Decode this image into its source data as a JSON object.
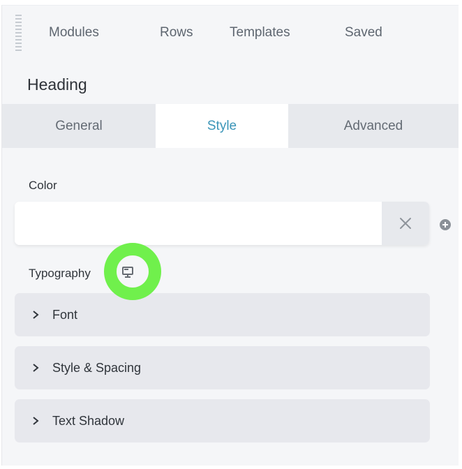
{
  "nav": {
    "items": [
      {
        "label": "Modules"
      },
      {
        "label": "Rows"
      },
      {
        "label": "Templates"
      },
      {
        "label": "Saved"
      }
    ]
  },
  "panel": {
    "title": "Heading"
  },
  "tabs": [
    {
      "label": "General",
      "active": false
    },
    {
      "label": "Style",
      "active": true
    },
    {
      "label": "Advanced",
      "active": false
    }
  ],
  "style": {
    "color": {
      "label": "Color",
      "value": "",
      "clear_icon": "close-icon",
      "add_icon": "plus-circle-icon"
    },
    "typography": {
      "label": "Typography",
      "responsive_icon": "desktop-icon",
      "sections": [
        {
          "label": "Font",
          "expanded": false
        },
        {
          "label": "Style & Spacing",
          "expanded": false
        },
        {
          "label": "Text Shadow",
          "expanded": false
        }
      ]
    }
  },
  "colors": {
    "accent": "#3b95b8",
    "highlight": "#70f04c",
    "panel_bg": "#f5f6f8",
    "tab_bg": "#e7e9ed"
  }
}
